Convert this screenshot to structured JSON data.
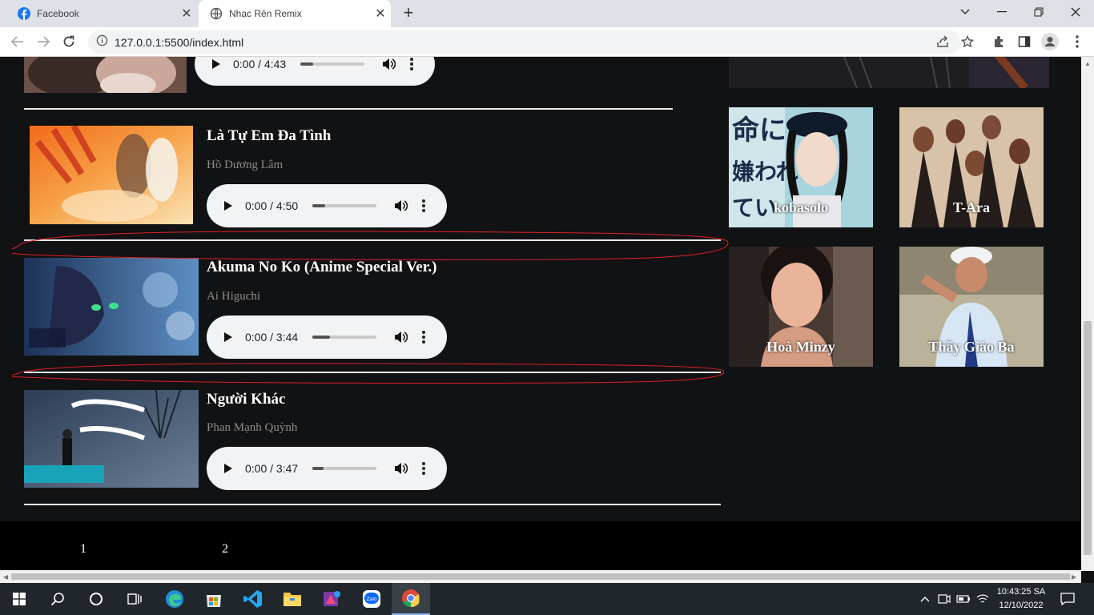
{
  "browser": {
    "tabs": [
      {
        "title": "Facebook",
        "active": false
      },
      {
        "title": "Nhạc Rên Remix",
        "active": true
      }
    ],
    "url": "127.0.0.1:5500/index.html"
  },
  "songs": [
    {
      "title": "",
      "artist": "",
      "time": "0:00 / 4:43",
      "progress": 0.2
    },
    {
      "title": "Là Tự Em Đa Tình",
      "artist": "Hồ Dương Lâm",
      "time": "0:00 / 4:50",
      "progress": 0.2
    },
    {
      "title": "Akuma No Ko (Anime Special Ver.)",
      "artist": "Ai Higuchi",
      "time": "0:00 / 3:44",
      "progress": 0.28
    },
    {
      "title": "Người Khác",
      "artist": "Phan Mạnh Quỳnh",
      "time": "0:00 / 3:47",
      "progress": 0.17
    }
  ],
  "artists": [
    "kobasolo",
    "T-Ara",
    "Hoà Minzy",
    "Thầy Giáo Ba"
  ],
  "pagination": [
    "1",
    "2"
  ],
  "taskbar": {
    "time": "10:43:25 SA",
    "date": "12/10/2022"
  },
  "colors": {
    "page_bg": "#111214",
    "footer_bg": "#000000",
    "annotation_red": "#e02020",
    "divider": "#e8e8e8"
  }
}
